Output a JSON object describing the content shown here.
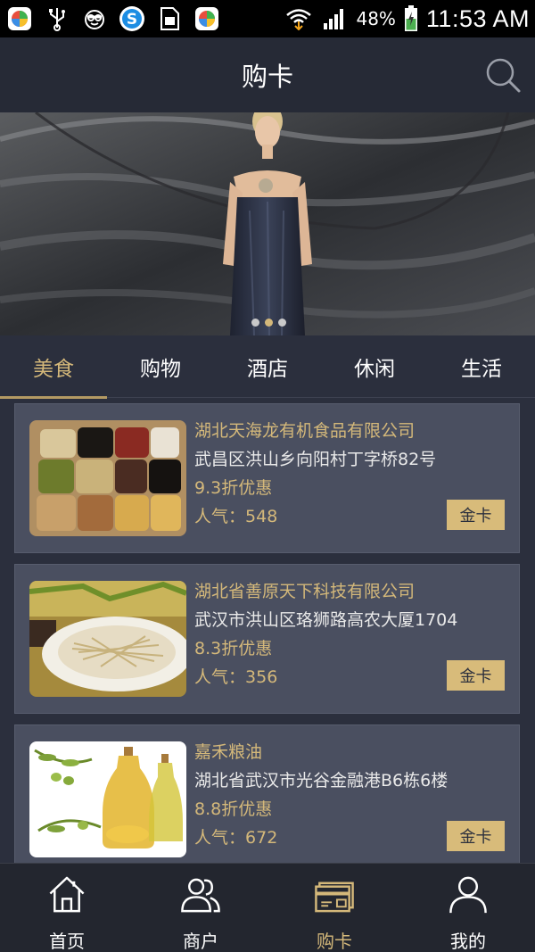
{
  "status_bar": {
    "battery": "48%",
    "time": "11:53 AM"
  },
  "header": {
    "title": "购卡"
  },
  "banner": {
    "slides": 3,
    "active_slide": 2
  },
  "tabs": [
    {
      "label": "美食",
      "active": true
    },
    {
      "label": "购物",
      "active": false
    },
    {
      "label": "酒店",
      "active": false
    },
    {
      "label": "休闲",
      "active": false
    },
    {
      "label": "生活",
      "active": false
    }
  ],
  "merchants": [
    {
      "name": "湖北天海龙有机食品有限公司",
      "address": "武昌区洪山乡向阳村丁字桥82号",
      "discount": "9.3折优惠",
      "popularity_label": "人气：",
      "popularity": "548",
      "button": "金卡"
    },
    {
      "name": "湖北省善原天下科技有限公司",
      "address": "武汉市洪山区珞狮路高农大厦1704",
      "discount": "8.3折优惠",
      "popularity_label": "人气：",
      "popularity": "356",
      "button": "金卡"
    },
    {
      "name": "嘉禾粮油",
      "address": "湖北省武汉市光谷金融港B6栋6楼",
      "discount": "8.8折优惠",
      "popularity_label": "人气：",
      "popularity": "672",
      "button": "金卡"
    }
  ],
  "bottom_nav": [
    {
      "label": "首页",
      "icon": "home-icon",
      "active": false
    },
    {
      "label": "商户",
      "icon": "merchants-icon",
      "active": false
    },
    {
      "label": "购卡",
      "icon": "card-icon",
      "active": true
    },
    {
      "label": "我的",
      "icon": "profile-icon",
      "active": false
    }
  ],
  "colors": {
    "accent": "#d4b87a",
    "background": "#2b2f3d",
    "card": "#4a4f60"
  }
}
